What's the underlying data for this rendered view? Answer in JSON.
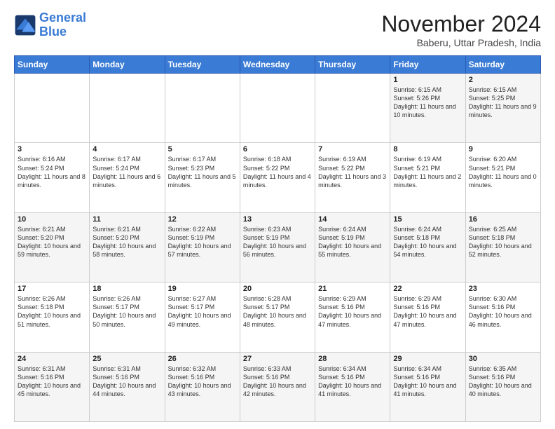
{
  "header": {
    "logo_line1": "General",
    "logo_line2": "Blue",
    "month_title": "November 2024",
    "location": "Baberu, Uttar Pradesh, India"
  },
  "weekdays": [
    "Sunday",
    "Monday",
    "Tuesday",
    "Wednesday",
    "Thursday",
    "Friday",
    "Saturday"
  ],
  "weeks": [
    [
      {
        "day": "",
        "info": ""
      },
      {
        "day": "",
        "info": ""
      },
      {
        "day": "",
        "info": ""
      },
      {
        "day": "",
        "info": ""
      },
      {
        "day": "",
        "info": ""
      },
      {
        "day": "1",
        "info": "Sunrise: 6:15 AM\nSunset: 5:26 PM\nDaylight: 11 hours and 10 minutes."
      },
      {
        "day": "2",
        "info": "Sunrise: 6:15 AM\nSunset: 5:25 PM\nDaylight: 11 hours and 9 minutes."
      }
    ],
    [
      {
        "day": "3",
        "info": "Sunrise: 6:16 AM\nSunset: 5:24 PM\nDaylight: 11 hours and 8 minutes."
      },
      {
        "day": "4",
        "info": "Sunrise: 6:17 AM\nSunset: 5:24 PM\nDaylight: 11 hours and 6 minutes."
      },
      {
        "day": "5",
        "info": "Sunrise: 6:17 AM\nSunset: 5:23 PM\nDaylight: 11 hours and 5 minutes."
      },
      {
        "day": "6",
        "info": "Sunrise: 6:18 AM\nSunset: 5:22 PM\nDaylight: 11 hours and 4 minutes."
      },
      {
        "day": "7",
        "info": "Sunrise: 6:19 AM\nSunset: 5:22 PM\nDaylight: 11 hours and 3 minutes."
      },
      {
        "day": "8",
        "info": "Sunrise: 6:19 AM\nSunset: 5:21 PM\nDaylight: 11 hours and 2 minutes."
      },
      {
        "day": "9",
        "info": "Sunrise: 6:20 AM\nSunset: 5:21 PM\nDaylight: 11 hours and 0 minutes."
      }
    ],
    [
      {
        "day": "10",
        "info": "Sunrise: 6:21 AM\nSunset: 5:20 PM\nDaylight: 10 hours and 59 minutes."
      },
      {
        "day": "11",
        "info": "Sunrise: 6:21 AM\nSunset: 5:20 PM\nDaylight: 10 hours and 58 minutes."
      },
      {
        "day": "12",
        "info": "Sunrise: 6:22 AM\nSunset: 5:19 PM\nDaylight: 10 hours and 57 minutes."
      },
      {
        "day": "13",
        "info": "Sunrise: 6:23 AM\nSunset: 5:19 PM\nDaylight: 10 hours and 56 minutes."
      },
      {
        "day": "14",
        "info": "Sunrise: 6:24 AM\nSunset: 5:19 PM\nDaylight: 10 hours and 55 minutes."
      },
      {
        "day": "15",
        "info": "Sunrise: 6:24 AM\nSunset: 5:18 PM\nDaylight: 10 hours and 54 minutes."
      },
      {
        "day": "16",
        "info": "Sunrise: 6:25 AM\nSunset: 5:18 PM\nDaylight: 10 hours and 52 minutes."
      }
    ],
    [
      {
        "day": "17",
        "info": "Sunrise: 6:26 AM\nSunset: 5:18 PM\nDaylight: 10 hours and 51 minutes."
      },
      {
        "day": "18",
        "info": "Sunrise: 6:26 AM\nSunset: 5:17 PM\nDaylight: 10 hours and 50 minutes."
      },
      {
        "day": "19",
        "info": "Sunrise: 6:27 AM\nSunset: 5:17 PM\nDaylight: 10 hours and 49 minutes."
      },
      {
        "day": "20",
        "info": "Sunrise: 6:28 AM\nSunset: 5:17 PM\nDaylight: 10 hours and 48 minutes."
      },
      {
        "day": "21",
        "info": "Sunrise: 6:29 AM\nSunset: 5:16 PM\nDaylight: 10 hours and 47 minutes."
      },
      {
        "day": "22",
        "info": "Sunrise: 6:29 AM\nSunset: 5:16 PM\nDaylight: 10 hours and 47 minutes."
      },
      {
        "day": "23",
        "info": "Sunrise: 6:30 AM\nSunset: 5:16 PM\nDaylight: 10 hours and 46 minutes."
      }
    ],
    [
      {
        "day": "24",
        "info": "Sunrise: 6:31 AM\nSunset: 5:16 PM\nDaylight: 10 hours and 45 minutes."
      },
      {
        "day": "25",
        "info": "Sunrise: 6:31 AM\nSunset: 5:16 PM\nDaylight: 10 hours and 44 minutes."
      },
      {
        "day": "26",
        "info": "Sunrise: 6:32 AM\nSunset: 5:16 PM\nDaylight: 10 hours and 43 minutes."
      },
      {
        "day": "27",
        "info": "Sunrise: 6:33 AM\nSunset: 5:16 PM\nDaylight: 10 hours and 42 minutes."
      },
      {
        "day": "28",
        "info": "Sunrise: 6:34 AM\nSunset: 5:16 PM\nDaylight: 10 hours and 41 minutes."
      },
      {
        "day": "29",
        "info": "Sunrise: 6:34 AM\nSunset: 5:16 PM\nDaylight: 10 hours and 41 minutes."
      },
      {
        "day": "30",
        "info": "Sunrise: 6:35 AM\nSunset: 5:16 PM\nDaylight: 10 hours and 40 minutes."
      }
    ]
  ]
}
